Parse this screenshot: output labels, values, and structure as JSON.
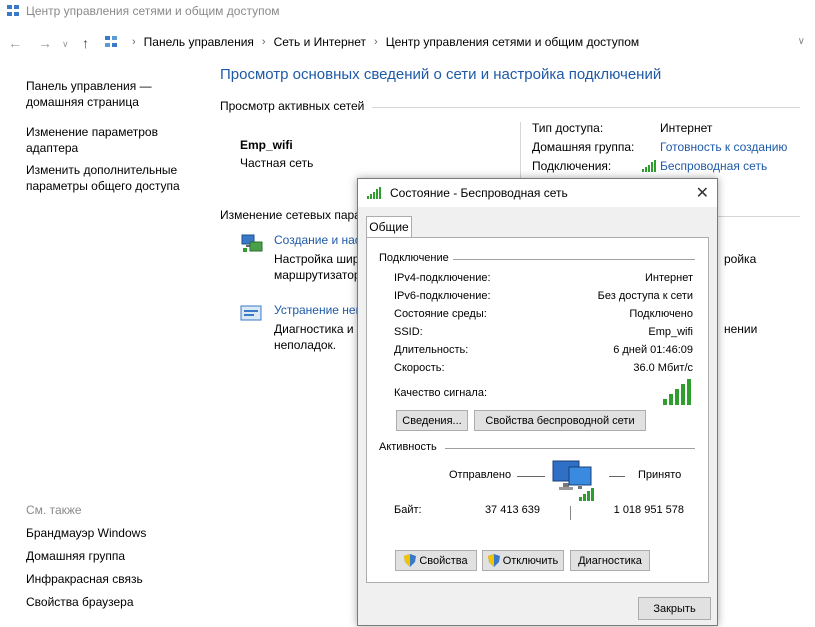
{
  "window": {
    "title": "Центр управления сетями и общим доступом"
  },
  "address_bar": {
    "crumbs": [
      "Панель управления",
      "Сеть и Интернет",
      "Центр управления сетями и общим доступом"
    ]
  },
  "sidebar": {
    "items": [
      {
        "label_line1": "Панель управления —",
        "label_line2": "домашняя страница"
      },
      {
        "label_line1": "Изменение параметров",
        "label_line2": "адаптера"
      },
      {
        "label_line1": "Изменить дополнительные",
        "label_line2": "параметры общего доступа"
      }
    ],
    "see_also_title": "См. также",
    "see_also": [
      "Брандмауэр Windows",
      "Домашняя группа",
      "Инфракрасная связь",
      "Свойства браузера"
    ]
  },
  "main": {
    "heading": "Просмотр основных сведений о сети и настройка подключений",
    "active_networks_title": "Просмотр активных сетей",
    "network_name": "Emp_wifi",
    "network_type": "Частная сеть",
    "access_type_label": "Тип доступа:",
    "access_type_value": "Интернет",
    "home_group_label": "Домашняя группа:",
    "home_group_value": "Готовность к созданию",
    "connections_label": "Подключения:",
    "connections_value": "Беспроводная сеть",
    "change_settings_title": "Изменение сетевых пара",
    "tasks": [
      {
        "title": "Создание и нас",
        "desc_line1": "Настройка шир",
        "desc_line2": "маршрутизатор",
        "desc_right": "ройка"
      },
      {
        "title": "Устранение неп",
        "desc_line1": "Диагностика и",
        "desc_line2": "неполадок.",
        "desc_right": "нении"
      }
    ]
  },
  "dialog": {
    "title": "Состояние - Беспроводная сеть",
    "tab": "Общие",
    "connection_group": "Подключение",
    "rows": [
      {
        "key": "IPv4-подключение:",
        "value": "Интернет"
      },
      {
        "key": "IPv6-подключение:",
        "value": "Без доступа к сети"
      },
      {
        "key": "Состояние среды:",
        "value": "Подключено"
      },
      {
        "key": "SSID:",
        "value": "Emp_wifi"
      },
      {
        "key": "Длительность:",
        "value": "6 дней 01:46:09"
      },
      {
        "key": "Скорость:",
        "value": "36.0 Мбит/с"
      }
    ],
    "signal_label": "Качество сигнала:",
    "signal_level": "5/5",
    "details_button": "Сведения...",
    "wireless_props_button": "Свойства беспроводной сети",
    "activity_group": "Активность",
    "sent_label": "Отправлено",
    "received_label": "Принято",
    "bytes_label": "Байт:",
    "bytes_sent": "37 413 639",
    "bytes_received": "1 018 951 578",
    "properties_button": "Свойства",
    "disable_button": "Отключить",
    "diagnose_button": "Диагностика",
    "close_button": "Закрыть"
  },
  "colors": {
    "link": "#1e5aa8",
    "signal": "#2e9e2e",
    "dialog_bg": "#f0f0f0"
  }
}
